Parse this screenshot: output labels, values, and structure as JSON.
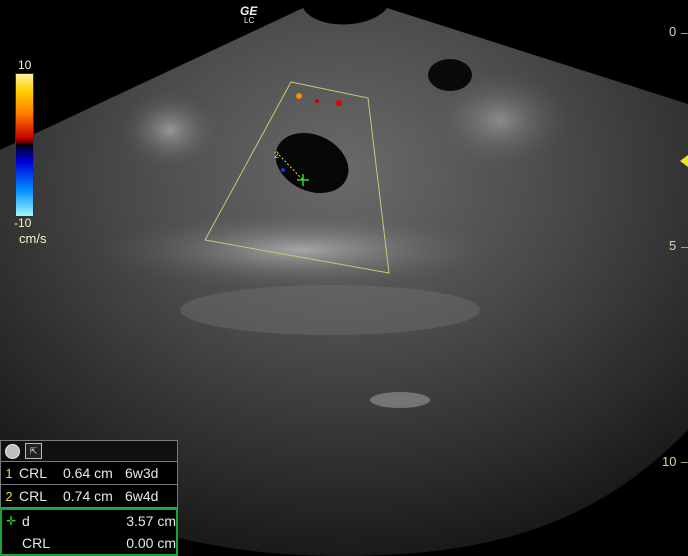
{
  "header": {
    "logo": "GE",
    "logo_sub": "LC"
  },
  "color_bar": {
    "top_label": "10",
    "bottom_label": "-10",
    "unit": "cm/s"
  },
  "depth_scale": [
    {
      "label": "0"
    },
    {
      "label": "5"
    },
    {
      "label": "10"
    }
  ],
  "measurements": {
    "rows": [
      {
        "index": "1",
        "label": "CRL",
        "value": "0.64 cm",
        "ga": "6w3d"
      },
      {
        "index": "2",
        "label": "CRL",
        "value": "0.74 cm",
        "ga": "6w4d"
      }
    ],
    "active": [
      {
        "label": "d",
        "value": "3.57 cm"
      },
      {
        "label": "CRL",
        "value": "0.00 cm"
      }
    ]
  },
  "colors": {
    "caliper_yellow": "#f0e030",
    "caliper_green": "#2fdc2f",
    "roi": "#c8c870"
  },
  "icons": [
    "circle-button-icon",
    "cursor-icon",
    "cross-caliper-icon"
  ]
}
